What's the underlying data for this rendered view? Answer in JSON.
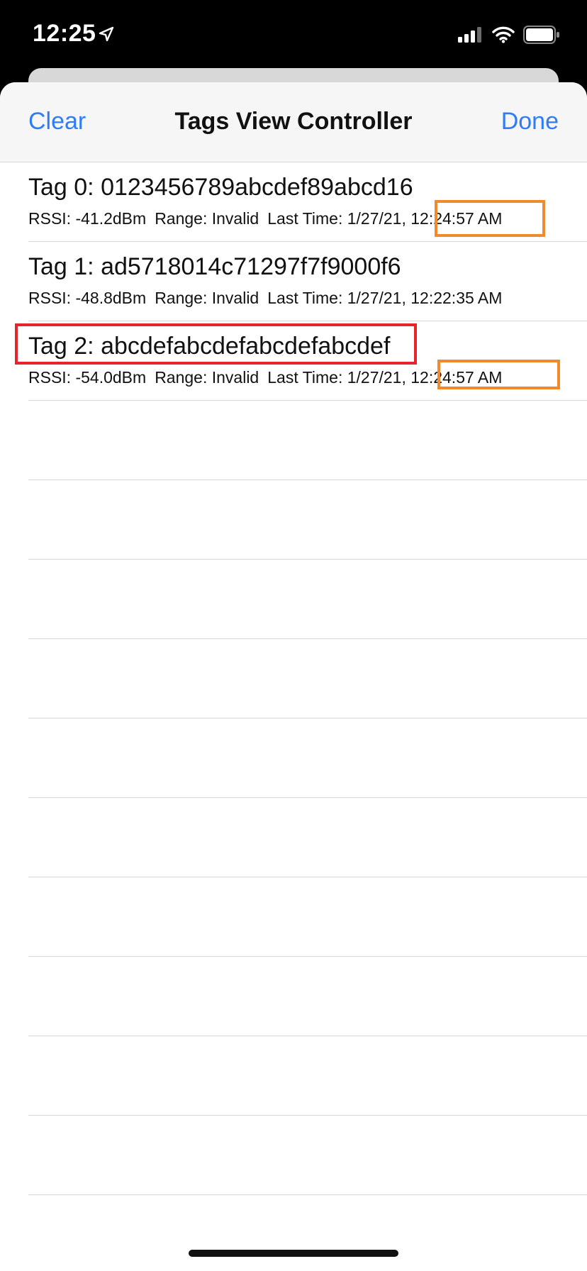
{
  "status_bar": {
    "time": "12:25",
    "icons": [
      "location-arrow-icon",
      "cellular-signal-icon",
      "wifi-icon",
      "battery-icon"
    ]
  },
  "nav": {
    "left_label": "Clear",
    "title": "Tags View Controller",
    "right_label": "Done",
    "accent_color": "#2f7cf6"
  },
  "tags": [
    {
      "title": "Tag 0: 0123456789abcdef89abcd16",
      "rssi": "RSSI: -41.2dBm",
      "range": "Range: Invalid",
      "last_time_prefix": "Last Time: 1/27/21,",
      "last_time_clock": "12:24:57 AM"
    },
    {
      "title": "Tag 1: ad5718014c71297f7f9000f6",
      "rssi": "RSSI: -48.8dBm",
      "range": "Range: Invalid",
      "last_time_prefix": "Last Time: 1/27/21,",
      "last_time_clock": "12:22:35 AM"
    },
    {
      "title": "Tag 2: abcdefabcdefabcdefabcdef",
      "rssi": "RSSI: -54.0dBm",
      "range": "Range: Invalid",
      "last_time_prefix": "Last Time: 1/27/21,",
      "last_time_clock": "12:24:57 AM"
    }
  ],
  "highlight_colors": {
    "red": "#e5252a",
    "orange": "#f08a2c"
  }
}
